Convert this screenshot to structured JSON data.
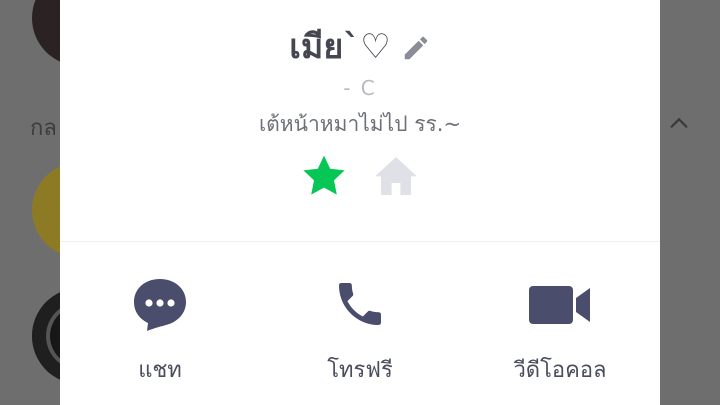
{
  "background": {
    "section_label": "กล"
  },
  "profile": {
    "name": "เมีย`♡",
    "status_id": "- C",
    "status_message": "เต้หน้าหมาไม่ไป รร.~"
  },
  "icons": {
    "edit": "pencil-icon",
    "favorite": "star-icon",
    "home": "home-icon",
    "chat": "chat-bubble-icon",
    "call": "phone-icon",
    "video": "video-camera-icon"
  },
  "actions": {
    "chat_label": "แชท",
    "call_label": "โทรฟรี",
    "video_label": "วีดีโอคอล"
  },
  "colors": {
    "accent_green": "#06c755",
    "icon_dark": "#4a4d6b",
    "inactive_gray": "#dfe1e6"
  }
}
